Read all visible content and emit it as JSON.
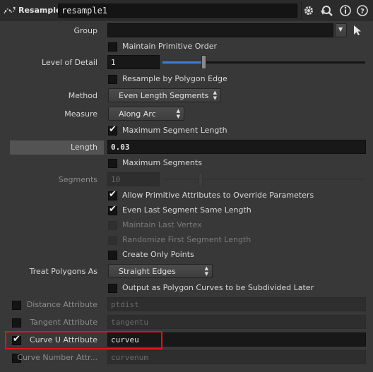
{
  "header": {
    "node_type": "Resample",
    "node_name": "resample1",
    "icons": [
      "gear-icon",
      "search-icon",
      "info-icon",
      "help-icon"
    ]
  },
  "group": {
    "label": "Group",
    "value": ""
  },
  "maintain_primitive_order": {
    "label": "Maintain Primitive Order",
    "checked": false
  },
  "level_of_detail": {
    "label": "Level of Detail",
    "value": "1"
  },
  "resample_by_polygon_edge": {
    "label": "Resample by Polygon Edge",
    "checked": false
  },
  "method": {
    "label": "Method",
    "value": "Even Length Segments"
  },
  "measure": {
    "label": "Measure",
    "value": "Along Arc"
  },
  "maximum_segment_length": {
    "label": "Maximum Segment Length",
    "checked": true
  },
  "length": {
    "label": "Length",
    "value": "0.03"
  },
  "maximum_segments": {
    "label": "Maximum Segments",
    "checked": false
  },
  "segments": {
    "label": "Segments",
    "value": "10"
  },
  "allow_prim_attribs": {
    "label": "Allow Primitive Attributes to Override Parameters",
    "checked": true
  },
  "even_last_segment": {
    "label": "Even Last Segment Same Length",
    "checked": true
  },
  "maintain_last_vertex": {
    "label": "Maintain Last Vertex",
    "checked": false
  },
  "randomize_first_segment": {
    "label": "Randomize First Segment Length",
    "checked": false
  },
  "create_only_points": {
    "label": "Create Only Points",
    "checked": false
  },
  "treat_polygons_as": {
    "label": "Treat Polygons As",
    "value": "Straight Edges"
  },
  "output_polygon_curves": {
    "label": "Output as Polygon Curves to be Subdivided Later",
    "checked": false
  },
  "distance_attribute": {
    "label": "Distance Attribute",
    "value": "ptdist",
    "checked": false
  },
  "tangent_attribute": {
    "label": "Tangent Attribute",
    "value": "tangentu",
    "checked": false
  },
  "curve_u_attribute": {
    "label": "Curve U Attribute",
    "value": "curveu",
    "checked": true
  },
  "curve_number_attribute": {
    "label": "Curve Number Attr...",
    "value": "curvenum",
    "checked": false
  },
  "colors": {
    "highlight": "#e0141c",
    "slider_accent": "#3d7fd6"
  }
}
